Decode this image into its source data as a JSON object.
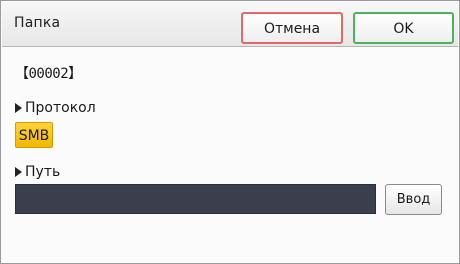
{
  "header": {
    "title": "Папка",
    "cancel_label": "Отмена",
    "ok_label": "OK"
  },
  "folder": {
    "code": "【00002】"
  },
  "protocol": {
    "label": "Протокол",
    "selected": "SMB"
  },
  "path": {
    "label": "Путь",
    "value": "",
    "enter_label": "Ввод"
  },
  "colors": {
    "cancel_border": "#e06a6a",
    "ok_border": "#4cb25b",
    "selected_option": "#f5c000",
    "path_field": "#3b3f4d"
  }
}
